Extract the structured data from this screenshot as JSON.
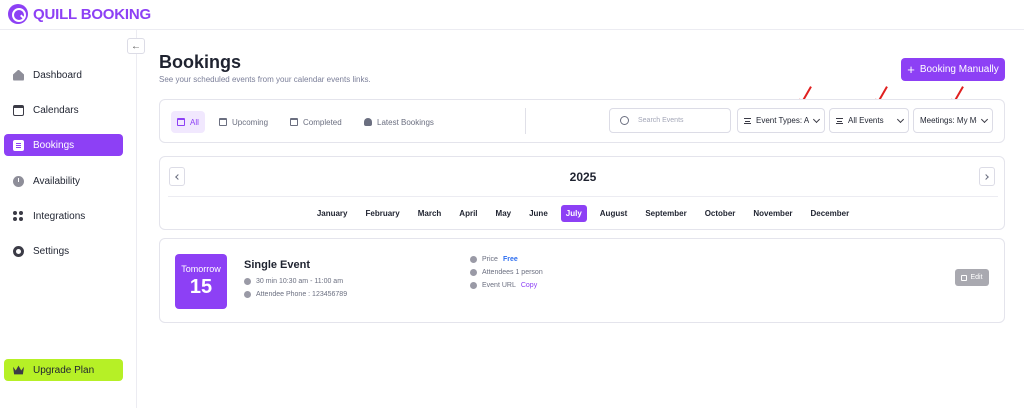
{
  "brand": {
    "name": "QUILL BOOKING"
  },
  "sidebar": {
    "collapse_glyph": "←",
    "items": [
      {
        "label": "Dashboard",
        "icon": "home-icon",
        "active": false
      },
      {
        "label": "Calendars",
        "icon": "calendar-icon",
        "active": false
      },
      {
        "label": "Bookings",
        "icon": "bookings-icon",
        "active": true
      },
      {
        "label": "Availability",
        "icon": "clock-icon",
        "active": false
      },
      {
        "label": "Integrations",
        "icon": "integrations-icon",
        "active": false
      },
      {
        "label": "Settings",
        "icon": "gear-icon",
        "active": false
      }
    ],
    "upgrade_label": "Upgrade Plan"
  },
  "header": {
    "title": "Bookings",
    "subtitle": "See your scheduled events from your calendar events links.",
    "booking_manually_label": "Booking Manually",
    "plus_glyph": "+"
  },
  "filters": {
    "tabs": [
      {
        "label": "All",
        "active": true
      },
      {
        "label": "Upcoming",
        "active": false
      },
      {
        "label": "Completed",
        "active": false
      },
      {
        "label": "Latest Bookings",
        "active": false
      }
    ],
    "search_placeholder": "Search Events",
    "event_types_value": "Event Types: Al",
    "all_events_value": "All Events",
    "meetings_value": "Meetings: My Me"
  },
  "calendar": {
    "year": "2025",
    "months": [
      "January",
      "February",
      "March",
      "April",
      "May",
      "June",
      "July",
      "August",
      "September",
      "October",
      "November",
      "December"
    ],
    "active_month": "July"
  },
  "booking": {
    "day_label": "Tomorrow",
    "day_number": "15",
    "title": "Single Event",
    "time": "30 min 10:30 am - 11:00 am",
    "attendee_phone": "Attendee Phone : 123456789",
    "price_label": "Price",
    "price_value": "Free",
    "attendees": "Attendees 1 person",
    "event_url_label": "Event URL",
    "copy_label": "Copy",
    "edit_label": "Edit"
  },
  "colors": {
    "accent": "#8d40f5",
    "upgrade": "#b6f026",
    "annotation_arrow": "#e02020",
    "free_price": "#2c6df0"
  }
}
